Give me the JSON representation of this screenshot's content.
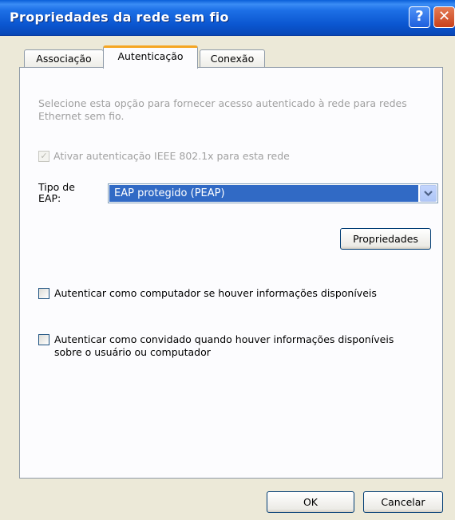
{
  "window": {
    "title": "Propriedades da rede sem fio",
    "help_glyph": "?",
    "close_glyph": "✕"
  },
  "tabs": [
    {
      "label": "Associação",
      "active": false
    },
    {
      "label": "Autenticação",
      "active": true
    },
    {
      "label": "Conexão",
      "active": false
    }
  ],
  "panel": {
    "description": "Selecione esta opção para fornecer acesso autenticado à rede para redes Ethernet sem fio.",
    "ieee_checkbox": {
      "label": "Ativar autenticação IEEE 802.1x para esta rede",
      "checked": true,
      "enabled": false
    },
    "eap_type": {
      "label": "Tipo de EAP:",
      "selected": "EAP protegido (PEAP)"
    },
    "properties_button": "Propriedades",
    "computer_auth_checkbox": {
      "label": "Autenticar como computador se houver informações disponíveis",
      "checked": false
    },
    "guest_auth_checkbox": {
      "label": "Autenticar como convidado quando houver informações disponíveis sobre o usuário ou computador",
      "checked": false
    }
  },
  "footer": {
    "ok_label": "OK",
    "cancel_label": "Cancelar"
  },
  "colors": {
    "titlebar": "#0b56d0",
    "selection": "#316ac5",
    "tab_highlight": "#f5a623",
    "dialog_bg": "#ece9d8"
  }
}
